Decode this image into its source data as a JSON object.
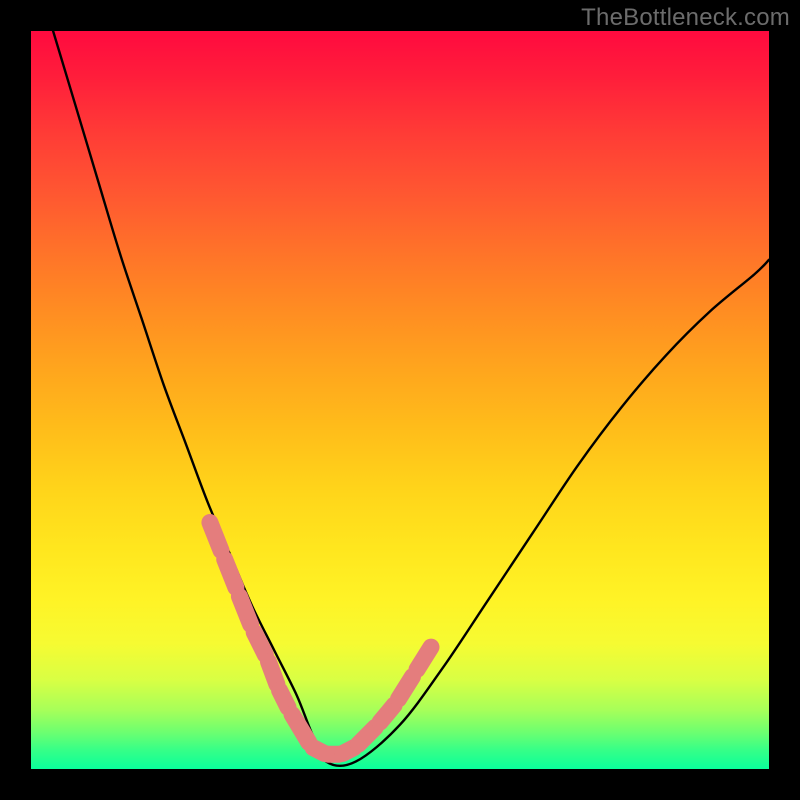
{
  "watermark": {
    "text": "TheBottleneck.com"
  },
  "gradient": {
    "stops": [
      {
        "pos": 0.0,
        "color": "#ff0a3f"
      },
      {
        "pos": 0.14,
        "color": "#ff3c36"
      },
      {
        "pos": 0.3,
        "color": "#ff7329"
      },
      {
        "pos": 0.46,
        "color": "#ffa61d"
      },
      {
        "pos": 0.62,
        "color": "#ffd41a"
      },
      {
        "pos": 0.77,
        "color": "#fff326"
      },
      {
        "pos": 0.88,
        "color": "#d8ff44"
      },
      {
        "pos": 0.95,
        "color": "#6dff70"
      },
      {
        "pos": 1.0,
        "color": "#0aff9b"
      }
    ]
  },
  "chart_data": {
    "type": "line",
    "title": "",
    "xlabel": "",
    "ylabel": "",
    "xlim": [
      0,
      100
    ],
    "ylim": [
      0,
      100
    ],
    "series": [
      {
        "name": "bottleneck-curve",
        "x": [
          3,
          6,
          9,
          12,
          15,
          18,
          21,
          24,
          27,
          30,
          33,
          36,
          38,
          40,
          44,
          50,
          56,
          62,
          68,
          74,
          80,
          86,
          92,
          98,
          100
        ],
        "y": [
          100,
          90,
          80,
          70,
          61,
          52,
          44,
          36,
          29,
          22,
          16,
          10,
          5,
          1,
          1,
          6,
          14,
          23,
          32,
          41,
          49,
          56,
          62,
          67,
          69
        ]
      },
      {
        "name": "marker-overlay",
        "x": [
          24,
          26,
          28,
          30,
          32,
          33.5,
          35,
          38,
          40,
          42,
          44,
          47,
          49.5,
          52,
          54.5
        ],
        "y": [
          34,
          29,
          24,
          19,
          15,
          11,
          8,
          3,
          2,
          2,
          3,
          6,
          9,
          13,
          17
        ]
      }
    ],
    "annotations": []
  },
  "colors": {
    "curve_stroke": "#000000",
    "marker_stroke": "#e47d7d",
    "background_frame": "#000000"
  }
}
